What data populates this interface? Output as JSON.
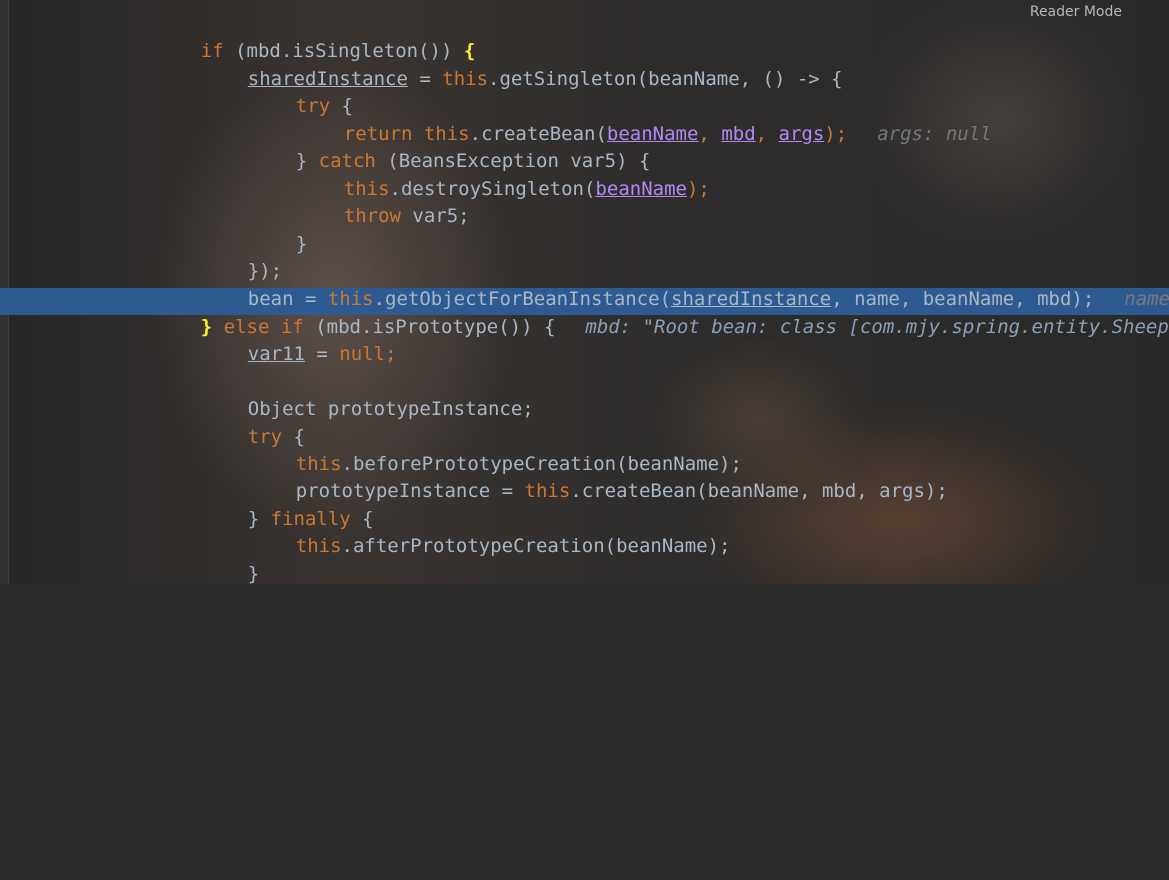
{
  "toolbar": {
    "reader_mode_label": "Reader Mode"
  },
  "code": {
    "l1": {
      "kw1": "if",
      "rest": " (mbd.isSingleton()) ",
      "brace": "{"
    },
    "l2": {
      "var": "sharedInstance",
      "eq": " = ",
      "this": "this",
      "rest": ".getSingleton(beanName, () -> {"
    },
    "l3": {
      "kw": "try",
      "rest": " {"
    },
    "l4": {
      "kw1": "return",
      "sp": " ",
      "this": "this",
      "call": ".createBean(",
      "p1": "beanName",
      "c1": ", ",
      "p2": "mbd",
      "c2": ", ",
      "p3": "args",
      "end": ");",
      "hint": "args: null"
    },
    "l5": {
      "pre": "} ",
      "kw": "catch",
      "rest": " (BeansException var5) {"
    },
    "l6": {
      "this": "this",
      "call": ".destroySingleton(",
      "p1": "beanName",
      "end": ");"
    },
    "l7": {
      "kw": "throw",
      "rest": " var5;"
    },
    "l8": {
      "text": "}"
    },
    "l9": {
      "text": "});"
    },
    "l10": {
      "pre": "bean = ",
      "this": "this",
      "call": ".getObjectForBeanInstance(",
      "v1": "sharedInstance",
      "rest": ", name, beanName, mbd);",
      "hint": "name"
    },
    "l11": {
      "brace": "}",
      "kw1": " else ",
      "kw2": "if",
      "rest": " (mbd.isPrototype()) {",
      "hint": "mbd: \"Root bean: class [com.mjy.spring.entity.Sheep"
    },
    "l12": {
      "var": "var11",
      "eq": " = ",
      "kw": "null",
      "end": ";"
    },
    "l13": {
      "text": "Object prototypeInstance;"
    },
    "l14": {
      "kw": "try",
      "rest": " {"
    },
    "l15": {
      "this": "this",
      "rest": ".beforePrototypeCreation(beanName);"
    },
    "l16": {
      "pre": "prototypeInstance = ",
      "this": "this",
      "rest": ".createBean(beanName, mbd, args);"
    },
    "l17": {
      "pre": "} ",
      "kw": "finally",
      "rest": " {"
    },
    "l18": {
      "this": "this",
      "rest": ".afterPrototypeCreation(beanName);"
    },
    "l19": {
      "text": "}"
    }
  }
}
